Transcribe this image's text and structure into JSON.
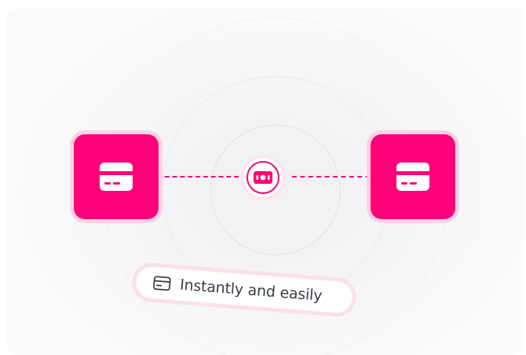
{
  "illustration": {
    "accent_color": "#fe0178",
    "accent_soft_color": "#fbd3e6",
    "left_tile_icon": "credit-card-icon",
    "right_tile_icon": "credit-card-icon",
    "center_icon": "money-transfer-icon",
    "badge": {
      "icon": "credit-card-icon",
      "label": "Instantly and easily"
    }
  }
}
